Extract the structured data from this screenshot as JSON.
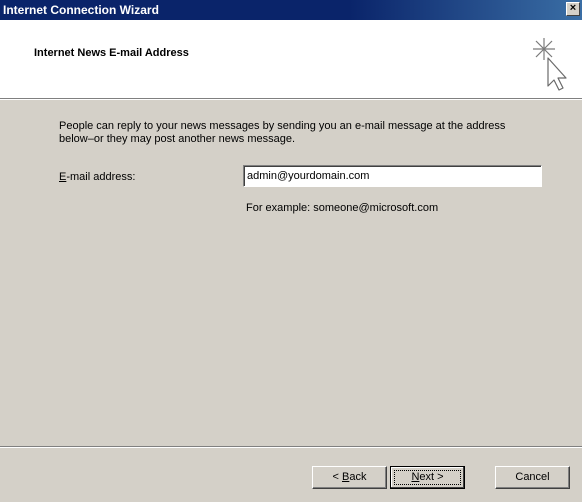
{
  "window": {
    "title": "Internet Connection Wizard",
    "close_glyph": "×"
  },
  "header": {
    "title": "Internet News E-mail Address",
    "icon": "wizard-cursor-sparkle-icon"
  },
  "content": {
    "description": "People can reply to your news messages by sending you an e-mail message at the address below–or they may post another news message.",
    "email_label_accel": "E",
    "email_label_rest": "-mail address:",
    "email_value": "admin@yourdomain.com",
    "example_text": "For example: someone@microsoft.com"
  },
  "buttons": {
    "back_prefix": "< ",
    "back_accel": "B",
    "back_rest": "ack",
    "next_accel": "N",
    "next_rest": "ext >",
    "cancel": "Cancel"
  },
  "colors": {
    "titlebar": "#0a246a",
    "face": "#d4d0c8",
    "header_bg": "#ffffff"
  }
}
